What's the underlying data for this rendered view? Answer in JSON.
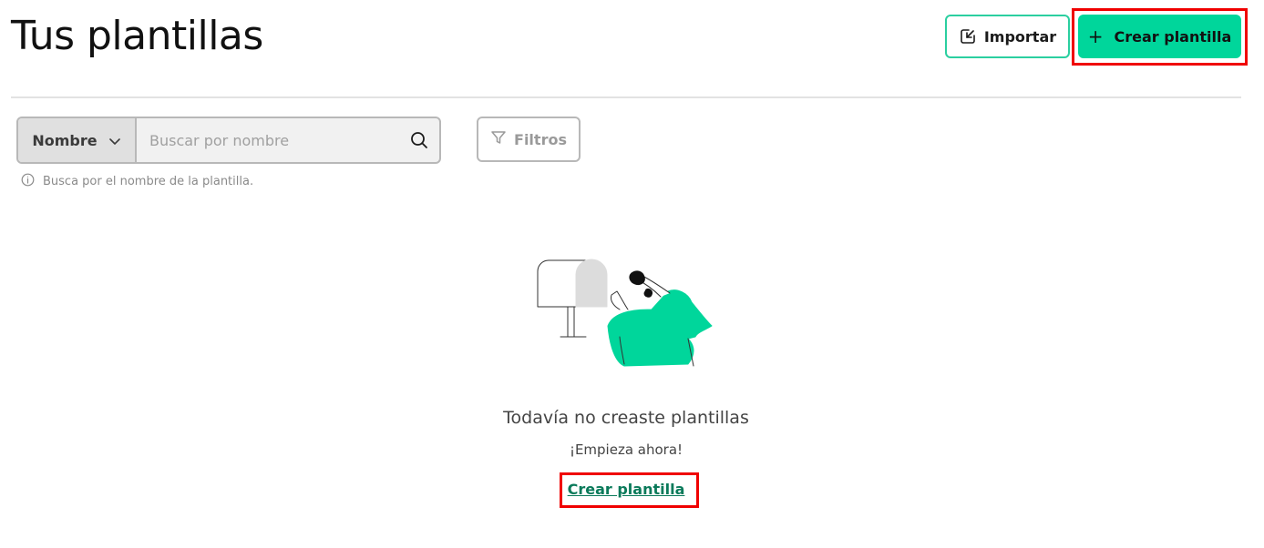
{
  "header": {
    "title": "Tus plantillas",
    "import_label": "Importar",
    "create_label": "Crear plantilla",
    "create_icon": "plus-icon",
    "import_icon": "import-icon"
  },
  "search": {
    "field_select_value": "Nombre",
    "placeholder": "Buscar por nombre",
    "hint": "Busca por el nombre de la plantilla.",
    "filters_label": "Filtros"
  },
  "empty_state": {
    "title": "Todavía no creaste plantillas",
    "subtitle": "¡Empieza ahora!",
    "link_label": "Crear plantilla"
  },
  "colors": {
    "accent": "#00d69b",
    "accent_border": "#2bcfa0",
    "link": "#0a7a5a",
    "highlight": "#f00000"
  }
}
